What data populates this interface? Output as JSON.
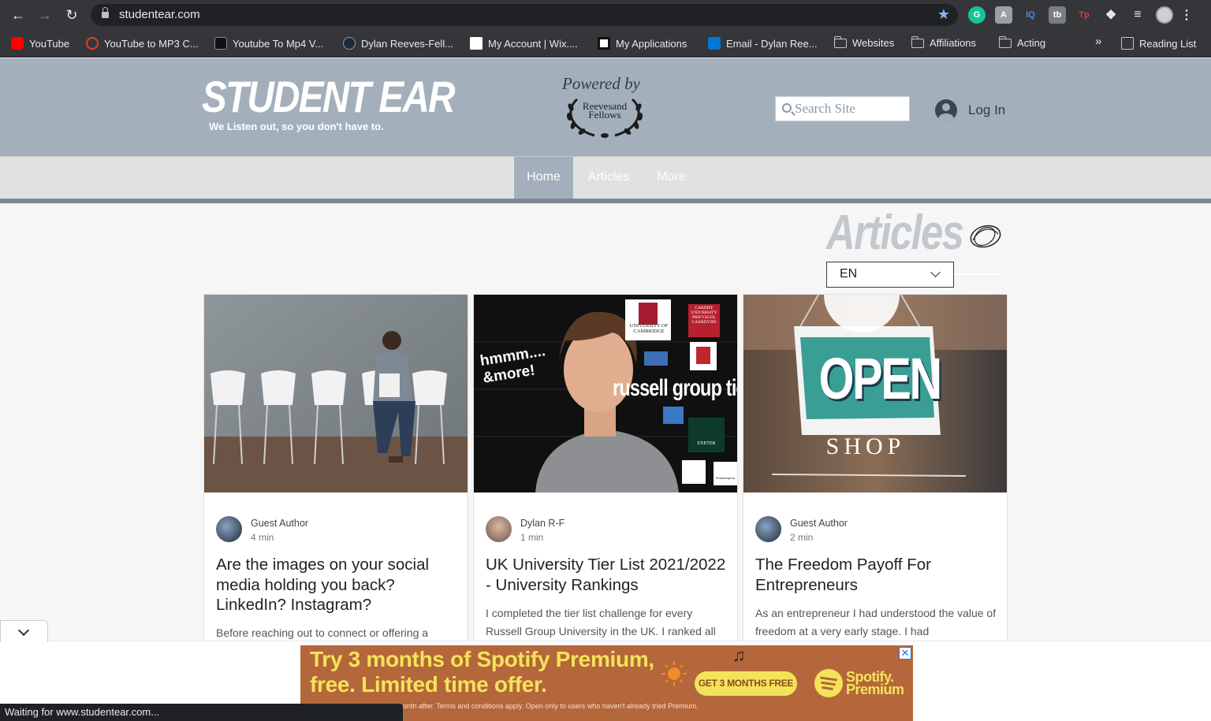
{
  "browser": {
    "url": "studentear.com",
    "bookmarks": [
      {
        "label": "YouTube",
        "color": "#ff0000"
      },
      {
        "label": "YouTube to MP3 C...",
        "color": "#e53935"
      },
      {
        "label": "Youtube To Mp4 V...",
        "color": "#222222"
      },
      {
        "label": "Dylan Reeves-Fell...",
        "color": "#1d2b3a"
      },
      {
        "label": "My Account | Wix....",
        "color": "#ffffff"
      },
      {
        "label": "My Applications",
        "color": "#ffffff"
      },
      {
        "label": "Email - Dylan Ree...",
        "color": "#0078d4"
      },
      {
        "label": "Websites"
      },
      {
        "label": "Affiliations"
      },
      {
        "label": "Acting"
      }
    ],
    "overflow_label": "»",
    "reading_list": "Reading List",
    "status": "Waiting for www.studentear.com..."
  },
  "site": {
    "logo": "STUDENT EAR",
    "tagline": "We Listen out, so you don't have to.",
    "powered_by": "Powered by",
    "sponsor_line1": "Reevesand",
    "sponsor_line2": "Fellows",
    "search_placeholder": "Search Site",
    "login": "Log In",
    "nav": [
      "Home",
      "Articles",
      "More"
    ]
  },
  "articles_section": {
    "title": "Articles",
    "language": "EN"
  },
  "cards": [
    {
      "author": "Guest Author",
      "read_time": "4 min",
      "title": "Are the images on your social media holding you back? LinkedIn? Instagram?",
      "excerpt": "Before reaching out to connect or offering a"
    },
    {
      "author": "Dylan R-F",
      "read_time": "1 min",
      "title": "UK University Tier List 2021/2022 - University Rankings",
      "excerpt": "I completed the tier list challenge for every Russell Group University in the UK. I ranked all",
      "image_text_1": "hmmm....",
      "image_text_2": "&more!",
      "image_text_3": "russell group tie",
      "logo_cambridge": "UNIVERSITY OF CAMBRIDGE",
      "logo_cardiff": "CARDIFF UNIVERSITY PRIFYSGOL CAERDYDD",
      "logo_exeter": "EXETER",
      "logo_southampton": "Southampton"
    },
    {
      "author": "Guest Author",
      "read_time": "2 min",
      "title": "The Freedom Payoff For Entrepreneurs",
      "excerpt": "As an entrepreneur I had understood the value of freedom at a very early stage. I had",
      "sign_big": "OPEN",
      "sign_small": "SHOP"
    }
  ],
  "ad": {
    "headline_1": "Try 3 months of Spotify Premium,",
    "headline_2": "free. Limited time offer.",
    "cta": "GET 3 MONTHS FREE",
    "brand_1": "Spotify.",
    "brand_2": "Premium",
    "fine_print": "onth after. Terms and conditions apply. Open only to users who haven't already tried Premium.",
    "close": "✕"
  },
  "colors": {
    "header_bg": "#a3b0bb",
    "ad_bg": "#b4673a",
    "ad_accent": "#f4e35a"
  }
}
